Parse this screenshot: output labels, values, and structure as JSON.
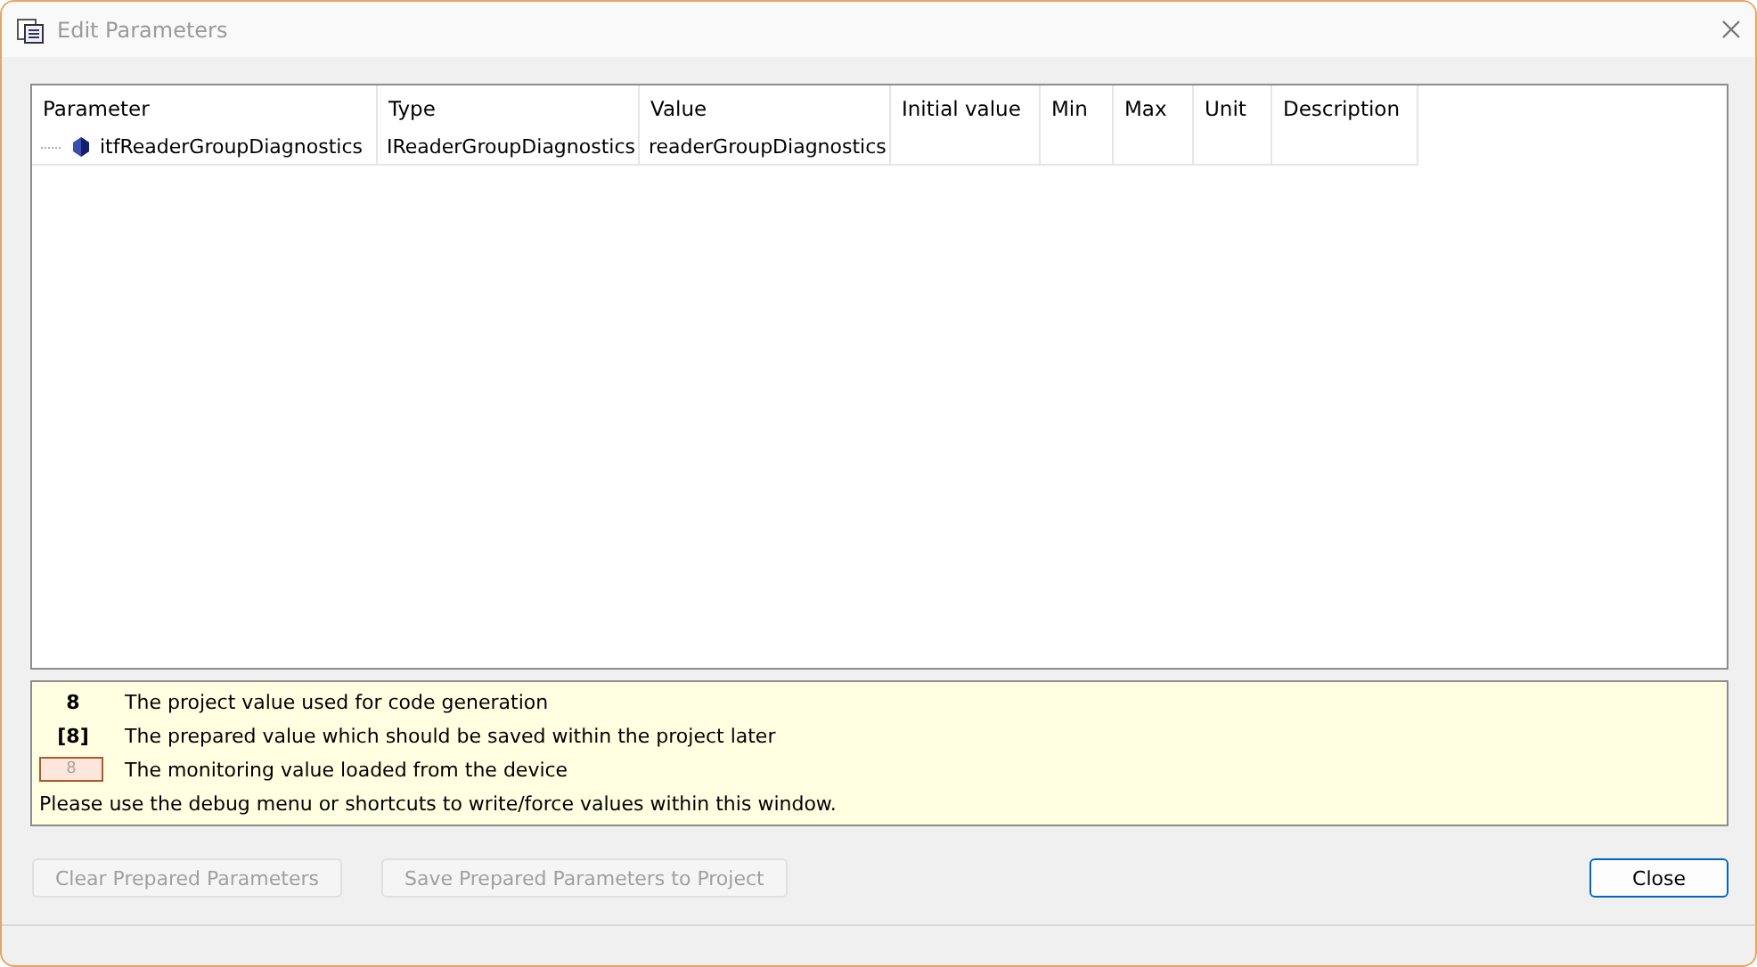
{
  "window": {
    "title": "Edit Parameters"
  },
  "table": {
    "columns": [
      "Parameter",
      "Type",
      "Value",
      "Initial value",
      "Min",
      "Max",
      "Unit",
      "Description"
    ],
    "rows": [
      {
        "cells": [
          "itfReaderGroupDiagnostics",
          "IReaderGroupDiagnostics",
          "readerGroupDiagnostics",
          "",
          "",
          "",
          "",
          ""
        ]
      }
    ]
  },
  "legend": {
    "items": [
      {
        "kind": "project",
        "sample": "8",
        "text": "The project value used for code generation"
      },
      {
        "kind": "prepared",
        "sample": "[8]",
        "text": "The prepared value which should be saved within the project later"
      },
      {
        "kind": "monitoring",
        "sample": "8",
        "text": "The monitoring value loaded from the device"
      }
    ],
    "note": "Please use the debug menu or shortcuts to write/force values within this window."
  },
  "buttons": [
    {
      "label": "Clear Prepared Parameters",
      "disabled": true
    },
    {
      "label": "Save Prepared Parameters to Project",
      "disabled": true
    }
  ],
  "close_button": {
    "label": "Close",
    "disabled": false
  }
}
